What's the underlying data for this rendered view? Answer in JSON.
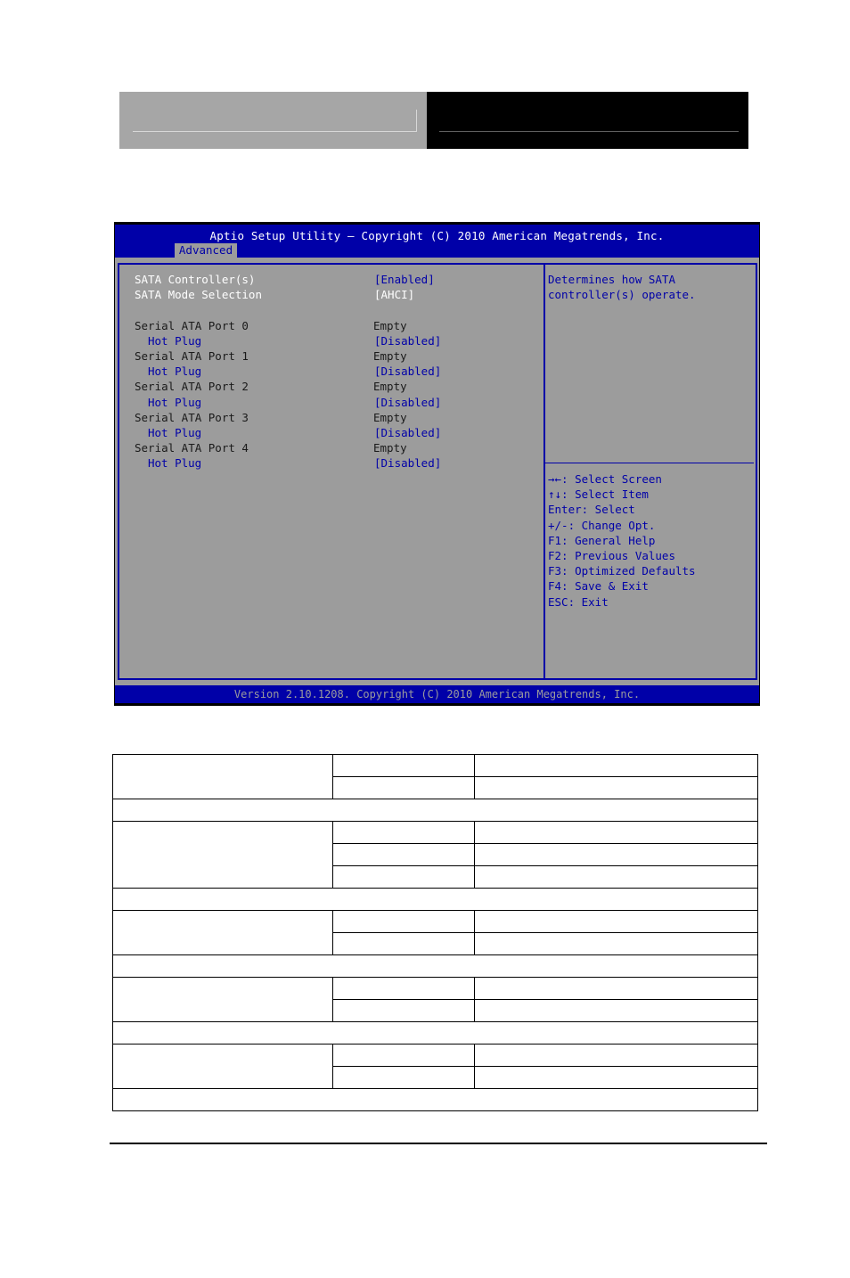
{
  "bios": {
    "title": "Aptio Setup Utility – Copyright (C) 2010 American Megatrends, Inc.",
    "active_tab": "Advanced",
    "footer": "Version 2.10.1208. Copyright (C) 2010 American Megatrends, Inc.",
    "settings": [
      {
        "label": "SATA Controller(s)",
        "value": "[Enabled]",
        "label_color": "white",
        "indent": false,
        "selectable": true
      },
      {
        "label": "SATA Mode Selection",
        "value": "[AHCI]",
        "label_color": "white",
        "indent": false,
        "selectable": false
      },
      {
        "label": "Serial ATA Port 0",
        "value": "Empty",
        "label_color": "black",
        "indent": false,
        "selectable": false
      },
      {
        "label": "Hot Plug",
        "value": "[Disabled]",
        "label_color": "blue",
        "indent": true,
        "selectable": true
      },
      {
        "label": "Serial ATA Port 1",
        "value": "Empty",
        "label_color": "black",
        "indent": false,
        "selectable": false
      },
      {
        "label": "Hot Plug",
        "value": "[Disabled]",
        "label_color": "blue",
        "indent": true,
        "selectable": true
      },
      {
        "label": "Serial ATA Port 2",
        "value": "Empty",
        "label_color": "black",
        "indent": false,
        "selectable": false
      },
      {
        "label": "Hot Plug",
        "value": "[Disabled]",
        "label_color": "blue",
        "indent": true,
        "selectable": true
      },
      {
        "label": "Serial ATA Port 3",
        "value": "Empty",
        "label_color": "black",
        "indent": false,
        "selectable": false
      },
      {
        "label": "Hot Plug",
        "value": "[Disabled]",
        "label_color": "blue",
        "indent": true,
        "selectable": true
      },
      {
        "label": "Serial ATA Port 4",
        "value": "Empty",
        "label_color": "black",
        "indent": false,
        "selectable": false
      },
      {
        "label": "Hot Plug",
        "value": "[Disabled]",
        "label_color": "blue",
        "indent": true,
        "selectable": true
      }
    ],
    "help": {
      "description": [
        "Determines how SATA",
        "controller(s) operate."
      ],
      "keys": [
        "→←: Select Screen",
        "↑↓: Select Item",
        "Enter: Select",
        "+/-: Change Opt.",
        "F1: General Help",
        "F2: Previous Values",
        "F3: Optimized Defaults",
        "F4: Save & Exit",
        "ESC: Exit"
      ]
    },
    "colors": {
      "blue": "#0000a8",
      "gray": "#9c9c9c",
      "white": "#ffffff"
    }
  },
  "table": {
    "groups": [
      {
        "sub_rows": 2
      },
      {
        "sub_rows": 3
      },
      {
        "sub_rows": 2
      },
      {
        "sub_rows": 2
      },
      {
        "sub_rows": 2
      }
    ]
  }
}
